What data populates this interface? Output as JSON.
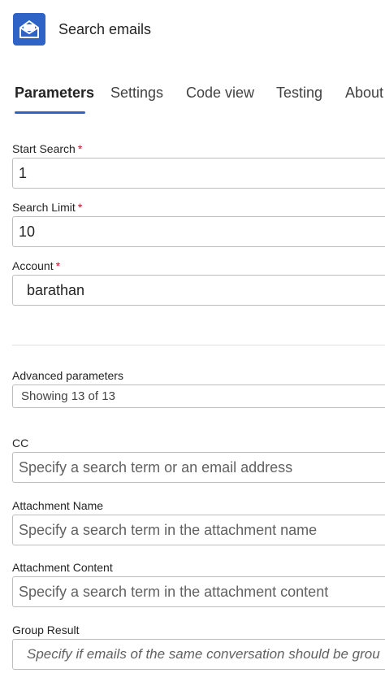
{
  "header": {
    "title": "Search emails",
    "icon": "envelope-open-icon",
    "icon_color": "#2f64c6"
  },
  "tabs": [
    {
      "label": "Parameters",
      "active": true
    },
    {
      "label": "Settings",
      "active": false
    },
    {
      "label": "Code view",
      "active": false
    },
    {
      "label": "Testing",
      "active": false
    },
    {
      "label": "About",
      "active": false
    }
  ],
  "fields": {
    "start_search": {
      "label": "Start Search",
      "required_mark": "*",
      "value": "1"
    },
    "search_limit": {
      "label": "Search Limit",
      "required_mark": "*",
      "value": "10"
    },
    "account": {
      "label": "Account",
      "required_mark": "*",
      "value": "barathan"
    }
  },
  "advanced": {
    "label": "Advanced parameters",
    "selected": "Showing 13 of 13"
  },
  "advanced_fields": {
    "cc": {
      "label": "CC",
      "placeholder": "Specify a search term or an email address"
    },
    "attachment_name": {
      "label": "Attachment Name",
      "placeholder": "Specify a search term in the attachment name"
    },
    "attachment_content": {
      "label": "Attachment Content",
      "placeholder": "Specify a search term in the attachment content"
    },
    "group_result": {
      "label": "Group Result",
      "placeholder": "Specify if emails of the same conversation should be grou"
    }
  },
  "colors": {
    "accent": "#2f64c6",
    "required": "#c50f1f"
  }
}
